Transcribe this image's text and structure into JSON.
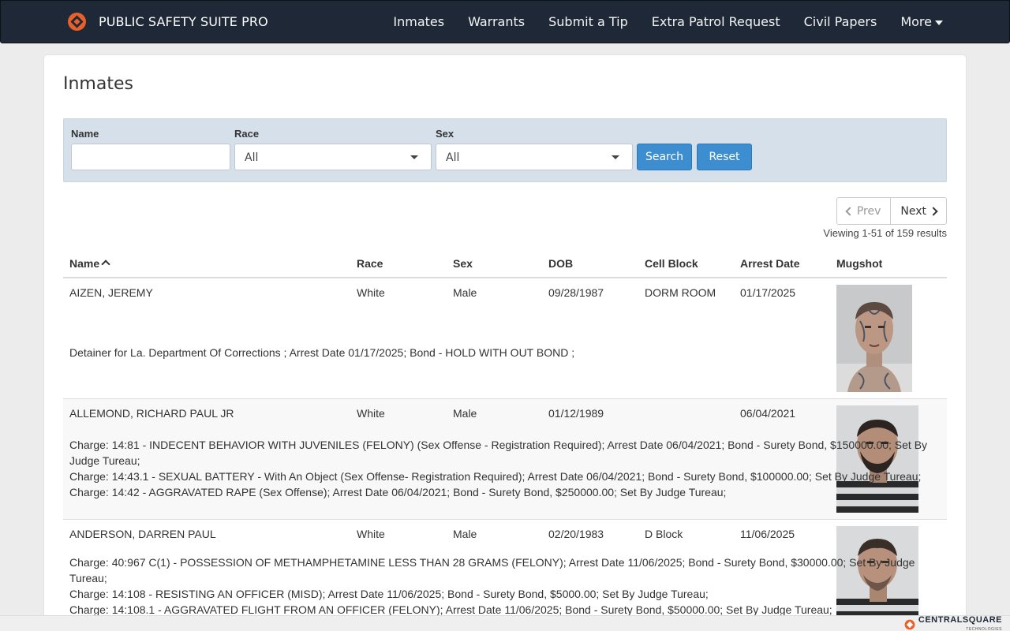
{
  "nav": {
    "brand": "PUBLIC SAFETY SUITE PRO",
    "links": [
      "Inmates",
      "Warrants",
      "Submit a Tip",
      "Extra Patrol Request",
      "Civil Papers",
      "More"
    ],
    "accent": "#e8612c"
  },
  "page": {
    "title": "Inmates"
  },
  "filter": {
    "name_label": "Name",
    "name_value": "",
    "race_label": "Race",
    "race_value": "All",
    "sex_label": "Sex",
    "sex_value": "All",
    "search_label": "Search",
    "reset_label": "Reset"
  },
  "pager": {
    "prev_label": "Prev",
    "next_label": "Next",
    "viewing": "Viewing 1-51 of 159 results"
  },
  "table": {
    "columns": [
      "Name",
      "Race",
      "Sex",
      "DOB",
      "Cell Block",
      "Arrest Date",
      "Mugshot"
    ],
    "rows": [
      {
        "name": "AIZEN, JEREMY",
        "race": "White",
        "sex": "Male",
        "dob": "09/28/1987",
        "cell_block": "DORM ROOM",
        "arrest_date": "01/17/2025",
        "charges": [
          "Detainer for La. Department Of Corrections ; Arrest Date 01/17/2025; Bond - HOLD WITH OUT BOND ;"
        ]
      },
      {
        "name": "ALLEMOND, RICHARD PAUL JR",
        "race": "White",
        "sex": "Male",
        "dob": "01/12/1989",
        "cell_block": "",
        "arrest_date": "06/04/2021",
        "charges": [
          "Charge: 14:81 - INDECENT BEHAVIOR WITH JUVENILES (FELONY) (Sex Offense - Registration Required); Arrest Date 06/04/2021; Bond - Surety Bond, $150000.00; Set By Judge Tureau;",
          "Charge: 14:43.1 - SEXUAL BATTERY - With An Object (Sex Offense- Registration Required); Arrest Date 06/04/2021; Bond - Surety Bond, $100000.00; Set By Judge Tureau;",
          "Charge: 14:42 - AGGRAVATED RAPE (Sex Offense); Arrest Date 06/04/2021; Bond - Surety Bond, $250000.00; Set By Judge Tureau;"
        ]
      },
      {
        "name": "ANDERSON, DARREN PAUL",
        "race": "White",
        "sex": "Male",
        "dob": "02/20/1983",
        "cell_block": "D Block",
        "arrest_date": "11/06/2025",
        "charges": [
          "Charge: 40:967 C(1) - POSSESSION OF METHAMPHETAMINE LESS THAN 28 GRAMS (FELONY); Arrest Date 11/06/2025; Bond - Surety Bond, $30000.00; Set By Judge Tureau;",
          "Charge: 14:108 - RESISTING AN OFFICER (MISD); Arrest Date 11/06/2025; Bond - Surety Bond, $5000.00; Set By Judge Tureau;",
          "Charge: 14:108.1 - AGGRAVATED FLIGHT FROM AN OFFICER (FELONY); Arrest Date 11/06/2025; Bond - Surety Bond, $50000.00; Set By Judge Tureau;"
        ]
      }
    ]
  },
  "footer": {
    "brand": "CENTRALSQUARE",
    "sub": "TECHNOLOGIES"
  }
}
